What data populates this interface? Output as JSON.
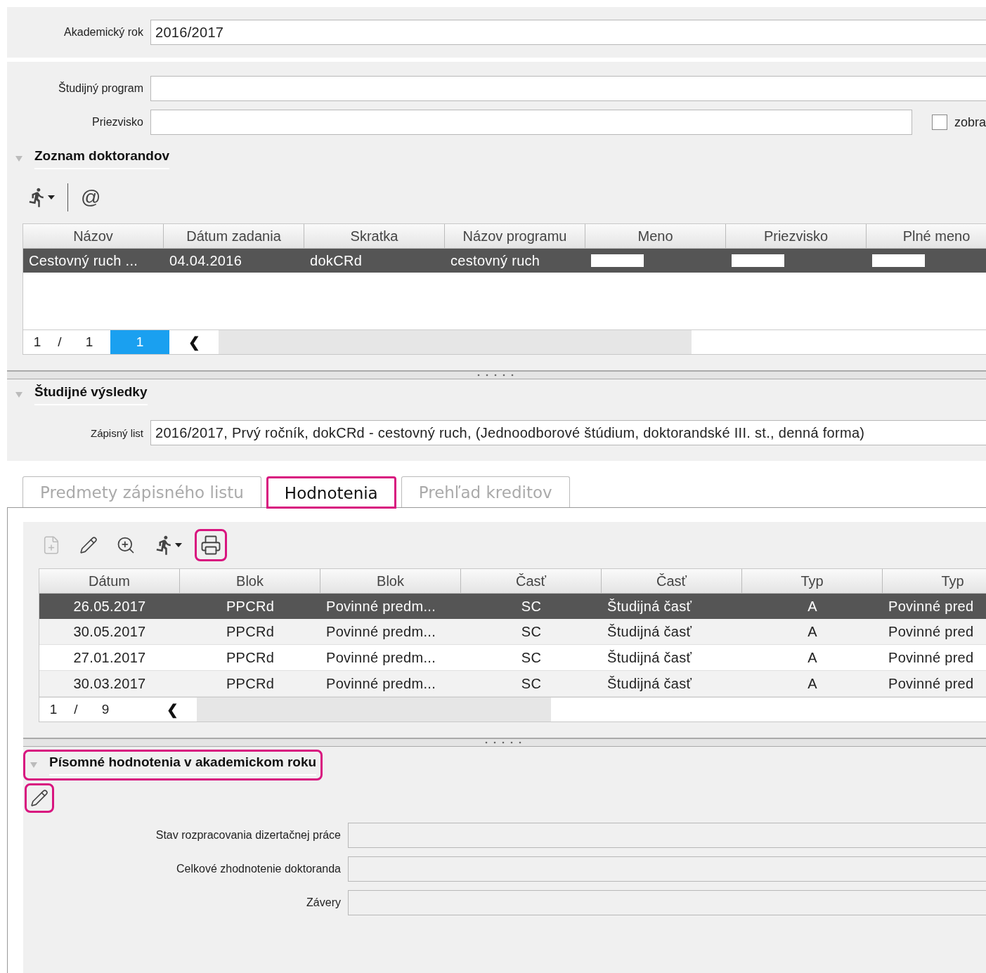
{
  "year_filter": {
    "fields": [
      {
        "label": "Akademický rok",
        "value": "2016/2017"
      }
    ]
  },
  "search_filter": {
    "fields": [
      {
        "label": "Študijný program"
      },
      {
        "label": "Priezvisko"
      }
    ],
    "checkbox": {
      "label": "zobra",
      "checked": false
    }
  },
  "students_section": {
    "title": "Zoznam doktorandov",
    "expanded": true,
    "toolbar": [
      {
        "kind": "run",
        "disabled": false,
        "highlighted": false
      },
      {
        "kind": "separator"
      },
      {
        "kind": "text",
        "text": "@",
        "disabled": false,
        "highlighted": false
      }
    ],
    "table": {
      "columns": [
        "Názov",
        "Dátum zadania",
        "Skratka",
        "Názov programu",
        "Meno",
        "Priezvisko",
        "Plné meno"
      ],
      "rows": [
        {
          "selected": true,
          "cells": [
            {
              "kind": "text",
              "text": "Cestovný ruch ..."
            },
            {
              "kind": "text",
              "text": "04.04.2016"
            },
            {
              "kind": "text",
              "text": "dokCRd"
            },
            {
              "kind": "text",
              "text": "cestovný ruch"
            },
            {
              "kind": "redacted"
            },
            {
              "kind": "redacted"
            },
            {
              "kind": "redacted"
            }
          ]
        }
      ],
      "pager": {
        "page": "1",
        "separator": "/",
        "total": "1",
        "current": "1",
        "prev": "❮"
      }
    }
  },
  "results_section": {
    "title": "Študijné výsledky",
    "expanded": true,
    "fields": [
      {
        "label": "Zápisný list",
        "value": "2016/2017, Prvý ročník, dokCRd - cestovný ruch, (Jednoodborové štúdium, doktorandské III. st., denná forma)"
      }
    ]
  },
  "tabs": [
    {
      "label": "Predmety zápisného listu",
      "selected": false,
      "highlighted": false
    },
    {
      "label": "Hodnotenia",
      "selected": true,
      "highlighted": true
    },
    {
      "label": "Prehľad kreditov",
      "selected": false,
      "highlighted": false
    }
  ],
  "evaluations": {
    "toolbar": [
      {
        "kind": "add",
        "disabled": true,
        "highlighted": false
      },
      {
        "kind": "edit",
        "disabled": false,
        "highlighted": false
      },
      {
        "kind": "zoom",
        "disabled": false,
        "highlighted": false
      },
      {
        "kind": "run",
        "disabled": false,
        "highlighted": false
      },
      {
        "kind": "print",
        "disabled": false,
        "highlighted": true
      }
    ],
    "table": {
      "columns": [
        "Dátum",
        "Blok",
        "Blok",
        "Časť",
        "Časť",
        "Typ",
        "Typ"
      ],
      "rows": [
        {
          "selected": true,
          "cells": [
            {
              "kind": "text",
              "text": "26.05.2017"
            },
            {
              "kind": "text",
              "text": "PPCRd"
            },
            {
              "kind": "text",
              "text": "Povinné predm..."
            },
            {
              "kind": "text",
              "text": "SC"
            },
            {
              "kind": "text",
              "text": "Študijná časť"
            },
            {
              "kind": "text",
              "text": "A"
            },
            {
              "kind": "text",
              "text": "Povinné pred"
            }
          ]
        },
        {
          "selected": false,
          "cells": [
            {
              "kind": "text",
              "text": "30.05.2017"
            },
            {
              "kind": "text",
              "text": "PPCRd"
            },
            {
              "kind": "text",
              "text": "Povinné predm..."
            },
            {
              "kind": "text",
              "text": "SC"
            },
            {
              "kind": "text",
              "text": "Študijná časť"
            },
            {
              "kind": "text",
              "text": "A"
            },
            {
              "kind": "text",
              "text": "Povinné pred"
            }
          ]
        },
        {
          "selected": false,
          "cells": [
            {
              "kind": "text",
              "text": "27.01.2017"
            },
            {
              "kind": "text",
              "text": "PPCRd"
            },
            {
              "kind": "text",
              "text": "Povinné predm..."
            },
            {
              "kind": "text",
              "text": "SC"
            },
            {
              "kind": "text",
              "text": "Študijná časť"
            },
            {
              "kind": "text",
              "text": "A"
            },
            {
              "kind": "text",
              "text": "Povinné pred"
            }
          ]
        },
        {
          "selected": false,
          "cells": [
            {
              "kind": "text",
              "text": "30.03.2017"
            },
            {
              "kind": "text",
              "text": "PPCRd"
            },
            {
              "kind": "text",
              "text": "Povinné predm..."
            },
            {
              "kind": "text",
              "text": "SC"
            },
            {
              "kind": "text",
              "text": "Študijná časť"
            },
            {
              "kind": "text",
              "text": "A"
            },
            {
              "kind": "text",
              "text": "Povinné pred"
            }
          ]
        }
      ],
      "pager": {
        "page": "1",
        "separator": "/",
        "total": "9",
        "prev": "❮"
      }
    }
  },
  "written_section": {
    "title": "Písomné hodnotenia v akademickom roku",
    "expanded": true,
    "highlighted": true,
    "toolbar": [
      {
        "kind": "edit",
        "disabled": false,
        "highlighted": true
      }
    ],
    "fields": [
      {
        "label": "Stav rozpracovania dizertačnej práce"
      },
      {
        "label": "Celkové zhodnotenie doktoranda"
      },
      {
        "label": "Závery"
      }
    ]
  }
}
